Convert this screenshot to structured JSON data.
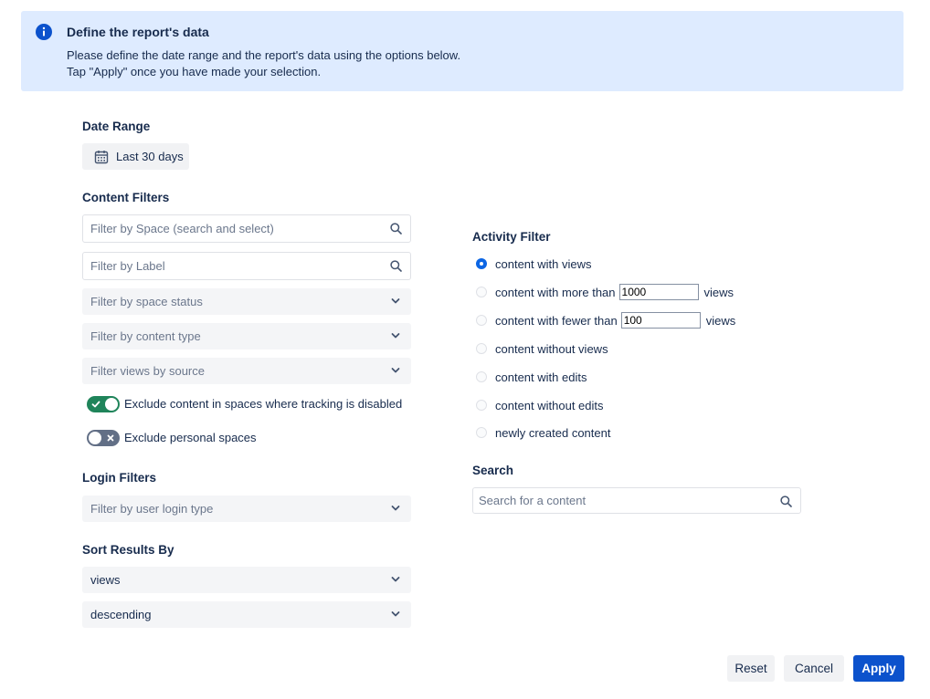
{
  "banner": {
    "title": "Define the report's data",
    "line1": "Please define the date range and the report's data using the options below.",
    "line2": "Tap \"Apply\" once you have made your selection.",
    "icon": "info-icon"
  },
  "date_range": {
    "label": "Date Range",
    "value": "Last 30 days",
    "icon": "calendar-icon"
  },
  "content_filters": {
    "label": "Content Filters",
    "space_placeholder": "Filter by Space (search and select)",
    "label_placeholder": "Filter by Label",
    "space_status": "Filter by space status",
    "content_type": "Filter by content type",
    "views_source": "Filter views by source",
    "toggle_tracking": {
      "label": "Exclude content in spaces where tracking is disabled",
      "on": true
    },
    "toggle_personal": {
      "label": "Exclude personal spaces",
      "on": false
    }
  },
  "login_filters": {
    "label": "Login Filters",
    "login_type": "Filter by user login type"
  },
  "sort": {
    "label": "Sort Results By",
    "field": "views",
    "order": "descending"
  },
  "activity_filter": {
    "label": "Activity Filter",
    "options": [
      {
        "label": "content with views",
        "checked": true
      },
      {
        "label": "content with more than",
        "value": "1000",
        "unit": "views",
        "checked": false
      },
      {
        "label": "content with fewer than",
        "value": "100",
        "unit": "views",
        "checked": false
      },
      {
        "label": "content without views",
        "checked": false
      },
      {
        "label": "content with edits",
        "checked": false
      },
      {
        "label": "content without edits",
        "checked": false
      },
      {
        "label": "newly created content",
        "checked": false
      }
    ]
  },
  "search": {
    "label": "Search",
    "placeholder": "Search for a content"
  },
  "buttons": {
    "reset": "Reset",
    "cancel": "Cancel",
    "apply": "Apply"
  },
  "colors": {
    "banner_bg": "#deebff",
    "primary": "#0c52cc",
    "toggle_on": "#1f845a",
    "toggle_off": "#626f86",
    "radio_checked": "#0c66e4"
  }
}
